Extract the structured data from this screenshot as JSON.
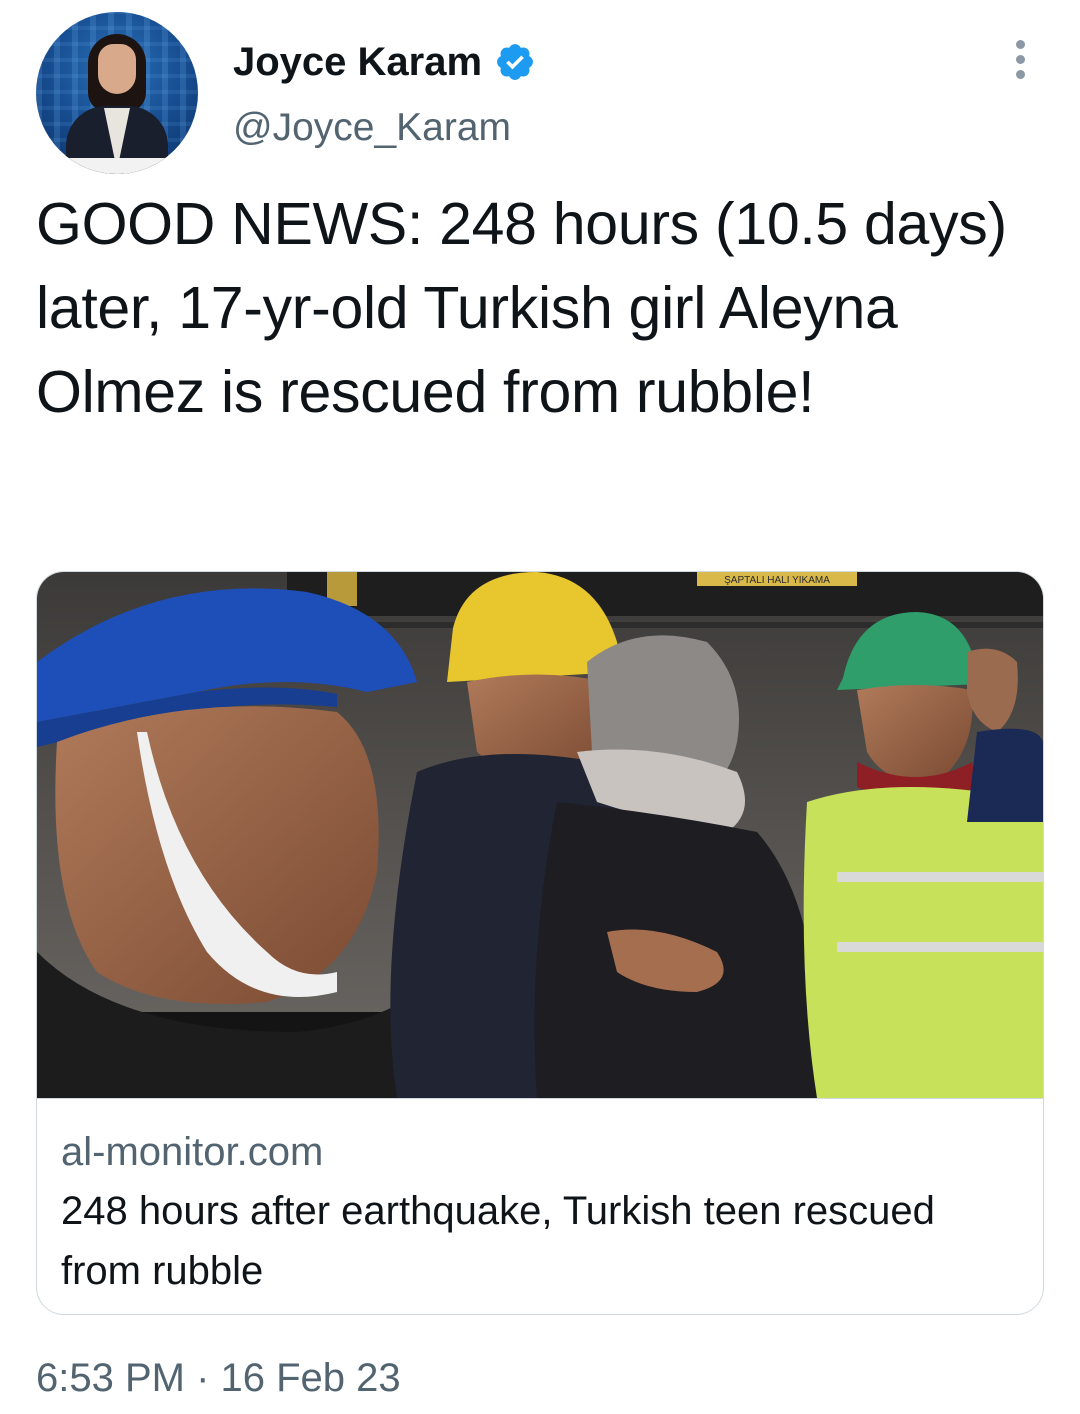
{
  "author": {
    "display_name": "Joyce Karam",
    "handle": "@Joyce_Karam",
    "verified": true,
    "avatar_icon": "profile-photo"
  },
  "tweet": {
    "text": "GOOD NEWS: 248 hours (10.5 days) later, 17-yr-old Turkish girl Aleyna Olmez is rescued from rubble!",
    "timestamp": "6:53 PM · 16 Feb 23"
  },
  "link_card": {
    "image_sign_text": "ŞAPTALI HALI YIKAMA",
    "domain": "al-monitor.com",
    "title": "248 hours after earthquake, Turkish teen rescued from rubble"
  },
  "colors": {
    "text_primary": "#0f1419",
    "text_secondary": "#536471",
    "verified_blue": "#1d9bf0",
    "border": "#cfd9de"
  },
  "icons": {
    "verified": "verified-badge-icon",
    "more": "more-options-icon"
  }
}
